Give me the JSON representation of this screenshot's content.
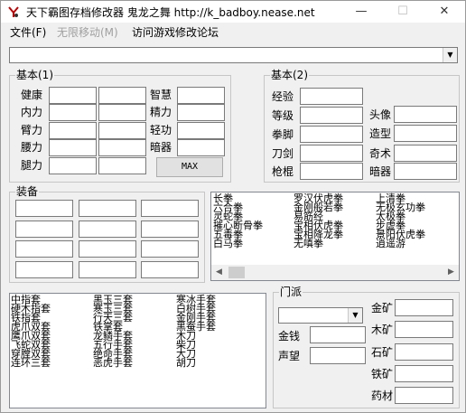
{
  "window": {
    "title": "天下霸图存档修改器 鬼龙之舞 http://k_badboy.nease.net",
    "minimize": "—",
    "maximize": "☐",
    "close": "✕"
  },
  "menu": {
    "file": "文件(F)",
    "infinite_move": "无限移动(M)",
    "forum": "访问游戏修改论坛"
  },
  "basic1": {
    "title": "基本(1)",
    "left_labels": [
      "健康",
      "内力",
      "臂力",
      "腰力",
      "腿力"
    ],
    "right_labels": [
      "智慧",
      "精力",
      "轻功",
      "暗器"
    ],
    "max_button": "MAX"
  },
  "basic2": {
    "title": "基本(2)",
    "left_labels": [
      "经验",
      "等级",
      "拳脚",
      "刀剑",
      "枪棍"
    ],
    "right_labels": [
      "头像",
      "造型",
      "奇术",
      "暗器"
    ]
  },
  "equip": {
    "title": "装备"
  },
  "skills_list": {
    "rows": [
      [
        "长拳",
        "罗汉伏虎拳",
        "上清拳"
      ],
      [
        "六合拳",
        "金刚般若拳",
        "无极玄功拳"
      ],
      [
        "灵蛇拳",
        "易筋经",
        "太极拳"
      ],
      [
        "摧心断骨拳",
        "宝相伏虎拳",
        "步虚拳"
      ],
      [
        "五毒拳",
        "宝相降龙拳",
        "景阳伏虎拳"
      ],
      [
        "白马拳",
        "无嗔拳",
        "逍遥游"
      ]
    ]
  },
  "items_list": {
    "rows": [
      [
        "中指套",
        "黑玉三套",
        "寒冰手套"
      ],
      [
        "硬木指套",
        "寒玉三套",
        "白树手套"
      ],
      [
        "铁指套",
        "行天三套",
        "金刚手套"
      ],
      [
        "虎爪双套",
        "铁掌套",
        "黑蚕手套"
      ],
      [
        "鹰爪双套",
        "龙鳞手套",
        "木刀"
      ],
      [
        "飞蛇双套",
        "五行手套",
        "柴刀"
      ],
      [
        "穿膛双套",
        "绝命手套",
        "大刀"
      ],
      [
        "连环三套",
        "恶虎手套",
        "胡刀"
      ]
    ]
  },
  "sect": {
    "title": "门派",
    "money_label": "金钱",
    "fame_label": "声望"
  },
  "mines": {
    "labels": [
      "金矿",
      "木矿",
      "石矿",
      "铁矿",
      "药材"
    ]
  }
}
